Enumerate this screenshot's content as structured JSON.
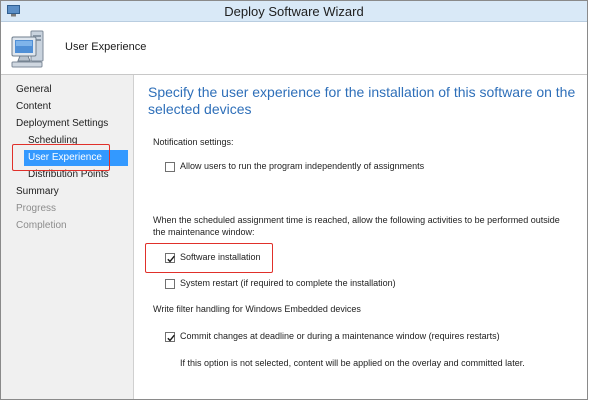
{
  "window": {
    "title": "Deploy Software Wizard",
    "page_name": "User Experience"
  },
  "sidebar": {
    "items": [
      {
        "label": "General",
        "state": "normal"
      },
      {
        "label": "Content",
        "state": "normal"
      },
      {
        "label": "Deployment Settings",
        "state": "normal"
      },
      {
        "label": "Scheduling",
        "state": "normal"
      },
      {
        "label": "User Experience",
        "state": "selected"
      },
      {
        "label": "Distribution Points",
        "state": "normal"
      },
      {
        "label": "Summary",
        "state": "normal"
      },
      {
        "label": "Progress",
        "state": "disabled"
      },
      {
        "label": "Completion",
        "state": "disabled"
      }
    ]
  },
  "main": {
    "heading": "Specify the user experience for the installation of this software on the selected devices",
    "notification_label": "Notification settings:",
    "allow_users": {
      "label": "Allow users to run the program independently of assignments",
      "checked": false
    },
    "outside_window_text": "When the scheduled assignment time is reached, allow the following activities to be performed outside the maintenance window:",
    "software_installation": {
      "label": "Software installation",
      "checked": true
    },
    "system_restart": {
      "label": "System restart  (if required to complete the installation)",
      "checked": false
    },
    "write_filter_label": "Write filter handling for Windows Embedded devices",
    "commit_changes": {
      "label": "Commit changes at deadline or during a maintenance window (requires restarts)",
      "checked": true
    },
    "commit_note": "If this option is not selected, content will be applied on the overlay and committed later."
  },
  "colors": {
    "accent_heading": "#2e6fb9",
    "selection": "#3399ff",
    "annotation_red": "#e0302a"
  },
  "icons": [
    "app-icon",
    "computer-icon",
    "checkmark-icon"
  ]
}
